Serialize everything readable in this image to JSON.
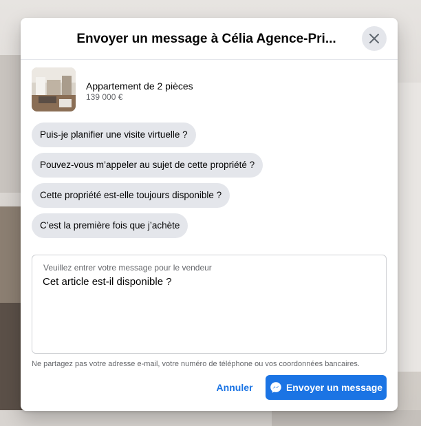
{
  "dialog": {
    "title": "Envoyer un message à Célia Agence-Pri..."
  },
  "listing": {
    "title": "Appartement de 2 pièces",
    "price": "139 000 €"
  },
  "suggestions": [
    "Puis-je planifier une visite virtuelle ?",
    "Pouvez-vous m’appeler au sujet de cette propriété ?",
    "Cette propriété est-elle toujours disponible ?",
    "C’est la première fois que j’achète"
  ],
  "message": {
    "label": "Veuillez entrer votre message pour le vendeur",
    "value": "Cet article est-il disponible ?"
  },
  "disclaimer": "Ne partagez pas votre adresse e-mail, votre numéro de téléphone ou vos coordonnées bancaires.",
  "actions": {
    "cancel": "Annuler",
    "send": "Envoyer un message"
  },
  "icons": {
    "close": "close-icon",
    "send": "messenger-icon"
  },
  "colors": {
    "primary": "#1b74e4",
    "chip_bg": "#e4e6eb",
    "text": "#050505",
    "secondary_text": "#65676b"
  }
}
